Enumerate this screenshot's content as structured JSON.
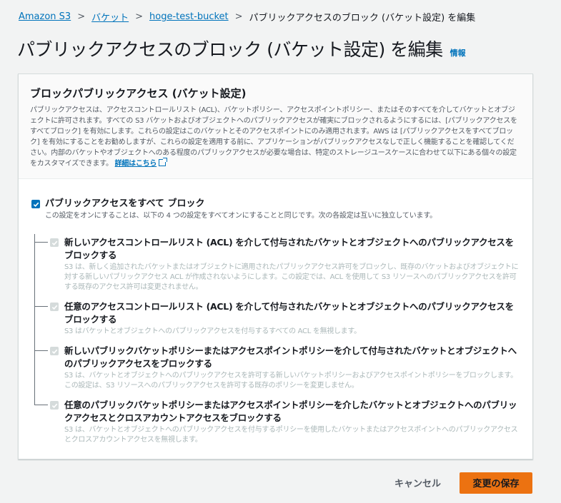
{
  "breadcrumb": {
    "items": [
      "Amazon S3",
      "バケット",
      "hoge-test-bucket"
    ],
    "current": "パブリックアクセスのブロック (バケット設定) を編集"
  },
  "page": {
    "title": "パブリックアクセスのブロック (バケット設定) を編集",
    "info_link": "情報"
  },
  "panel": {
    "title": "ブロックパブリックアクセス (バケット設定)",
    "description": "パブリックアクセスは、アクセスコントロールリスト (ACL)、バケットポリシー、アクセスポイントポリシー、またはそのすべてを介してバケットとオブジェクトに許可されます。すべての S3 バケットおよびオブジェクトへのパブリックアクセスが確実にブロックされるようにするには、[パブリックアクセスをすべてブロック] を有効にします。これらの設定はこのバケットとそのアクセスポイントにのみ適用されます。AWS は [パブリックアクセスをすべてブロック] を有効にすることをお勧めしますが、これらの設定を適用する前に、アプリケーションがパブリックアクセスなしで正しく機能することを確認してください。内部のバケットやオブジェクトへのある程度のパブリックアクセスが必要な場合は、特定のストレージユースケースに合わせて以下にある個々の設定をカスタマイズできます。",
    "more_link": "詳細はこちら"
  },
  "block_all": {
    "label": "パブリックアクセスをすべて ブロック",
    "description": "この設定をオンにすることは、以下の 4 つの設定をすべてオンにすることと同じです。次の各設定は互いに独立しています。",
    "checked": true
  },
  "options": [
    {
      "label": "新しいアクセスコントロールリスト (ACL) を介して付与されたバケットとオブジェクトへのパブリックアクセスをブロックする",
      "description": "S3 は、新しく追加されたバケットまたはオブジェクトに適用されたパブリックアクセス許可をブロックし、既存のバケットおよびオブジェクトに対する新しいパブリックアクセス ACL が作成されないようにします。この設定では、ACL を使用して S3 リソースへのパブリックアクセスを許可する既存のアクセス許可は変更されません。",
      "checked": true
    },
    {
      "label": "任意のアクセスコントロールリスト (ACL) を介して付与されたバケットとオブジェクトへのパブリックアクセスをブロックする",
      "description": "S3 はバケットとオブジェクトへのパブリックアクセスを付与するすべての ACL を無視します。",
      "checked": true
    },
    {
      "label": "新しいパブリックバケットポリシーまたはアクセスポイントポリシーを介して付与されたバケットとオブジェクトへのパブリックアクセスをブロックする",
      "description": "S3 は、バケットとオブジェクトへのパブリックアクセスを許可する新しいバケットポリシーおよびアクセスポイントポリシーをブロックします。この設定は、S3 リソースへのパブリックアクセスを許可する既存のポリシーを変更しません。",
      "checked": true
    },
    {
      "label": "任意のパブリックバケットポリシーまたはアクセスポイントポリシーを介したバケットとオブジェクトへのパブリックアクセスとクロスアカウントアクセスをブロックする",
      "description": "S3 は、バケットとオブジェクトへのパブリックアクセスを付与するポリシーを使用したバケットまたはアクセスポイントへのパブリックアクセスとクロスアカウントアクセスを無視します。",
      "checked": true
    }
  ],
  "actions": {
    "cancel": "キャンセル",
    "save": "変更の保存"
  },
  "colors": {
    "link": "#0073bb",
    "primary": "#ec7211",
    "background": "#f2f3f3"
  }
}
